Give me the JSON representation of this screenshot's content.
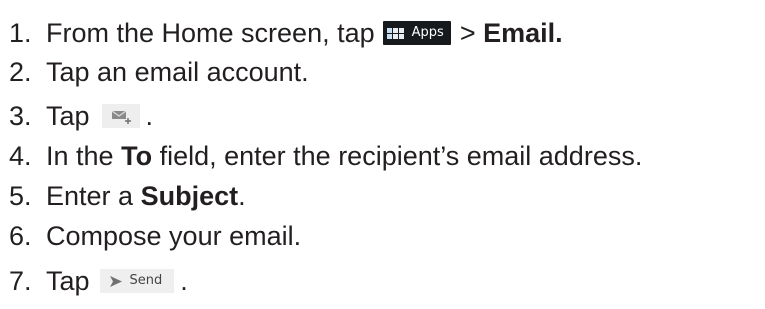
{
  "steps": [
    {
      "number": "1.",
      "text_before": "From the Home screen, tap",
      "apps_label": "Apps",
      "separator": ">",
      "bold_after": "Email."
    },
    {
      "number": "2.",
      "text": "Tap an email account."
    },
    {
      "number": "3.",
      "text_before": "Tap",
      "text_after": ".",
      "icon": "compose-mail-icon"
    },
    {
      "number": "4.",
      "text_before": "In the",
      "bold": "To",
      "text_after": "field, enter the recipient’s email address."
    },
    {
      "number": "5.",
      "text_before": "Enter a",
      "bold": "Subject",
      "text_after": "."
    },
    {
      "number": "6.",
      "text": "Compose your email."
    },
    {
      "number": "7.",
      "text_before": "Tap",
      "send_label": "Send",
      "text_after": ".",
      "icon": "send-arrow-icon"
    }
  ],
  "colors": {
    "text": "#231f20",
    "apps_badge_bg": "#171a1d",
    "button_bg": "#eeeeee",
    "icon_gray": "#7a7a7a"
  }
}
